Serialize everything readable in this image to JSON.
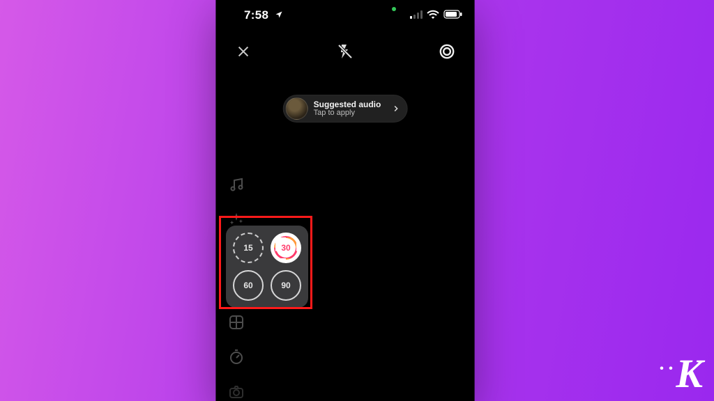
{
  "status": {
    "time": "7:58"
  },
  "toolbar": {
    "close": "close",
    "flash": "flash-off",
    "settings": "settings"
  },
  "pill": {
    "title": "Suggested audio",
    "subtitle": "Tap to apply"
  },
  "rail": {
    "items": [
      {
        "name": "music-icon"
      },
      {
        "name": "sparkle-icon"
      },
      {
        "name": "duration-icon"
      },
      {
        "name": "layout-icon"
      },
      {
        "name": "timer-icon"
      },
      {
        "name": "camera-icon"
      }
    ]
  },
  "durations": {
    "options": [
      {
        "label": "15",
        "style": "dashed",
        "selected": false
      },
      {
        "label": "30",
        "style": "selected",
        "selected": true
      },
      {
        "label": "60",
        "style": "solid",
        "selected": false
      },
      {
        "label": "90",
        "style": "solid",
        "selected": false
      }
    ]
  },
  "watermark": "K"
}
